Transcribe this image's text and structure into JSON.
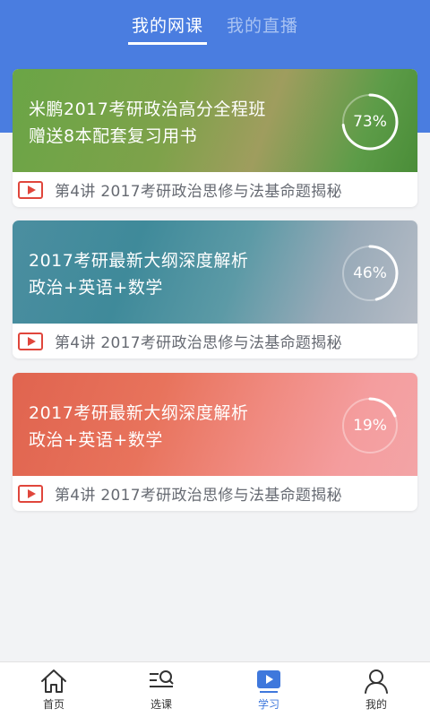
{
  "tabs": [
    {
      "label": "我的网课",
      "active": true
    },
    {
      "label": "我的直播",
      "active": false
    }
  ],
  "courses": [
    {
      "title_line1": "米鹏2017考研政治高分全程班",
      "title_line2": "赠送8本配套复习用书",
      "progress_label": "73%",
      "progress": 0.73,
      "lesson": "第4讲  2017考研政治思修与法基命题揭秘"
    },
    {
      "title_line1": "2017考研最新大纲深度解析",
      "title_line2": "政治+英语+数学",
      "progress_label": "46%",
      "progress": 0.46,
      "lesson": "第4讲  2017考研政治思修与法基命题揭秘"
    },
    {
      "title_line1": "2017考研最新大纲深度解析",
      "title_line2": "政治+英语+数学",
      "progress_label": "19%",
      "progress": 0.19,
      "lesson": "第4讲  2017考研政治思修与法基命题揭秘"
    }
  ],
  "nav": [
    {
      "label": "首页",
      "icon": "home-icon"
    },
    {
      "label": "选课",
      "icon": "search-list-icon"
    },
    {
      "label": "学习",
      "icon": "play-video-icon",
      "active": true
    },
    {
      "label": "我的",
      "icon": "user-icon"
    }
  ],
  "colors": {
    "header": "#4a7de0",
    "accent": "#3f78dc",
    "play": "#e0463c"
  }
}
